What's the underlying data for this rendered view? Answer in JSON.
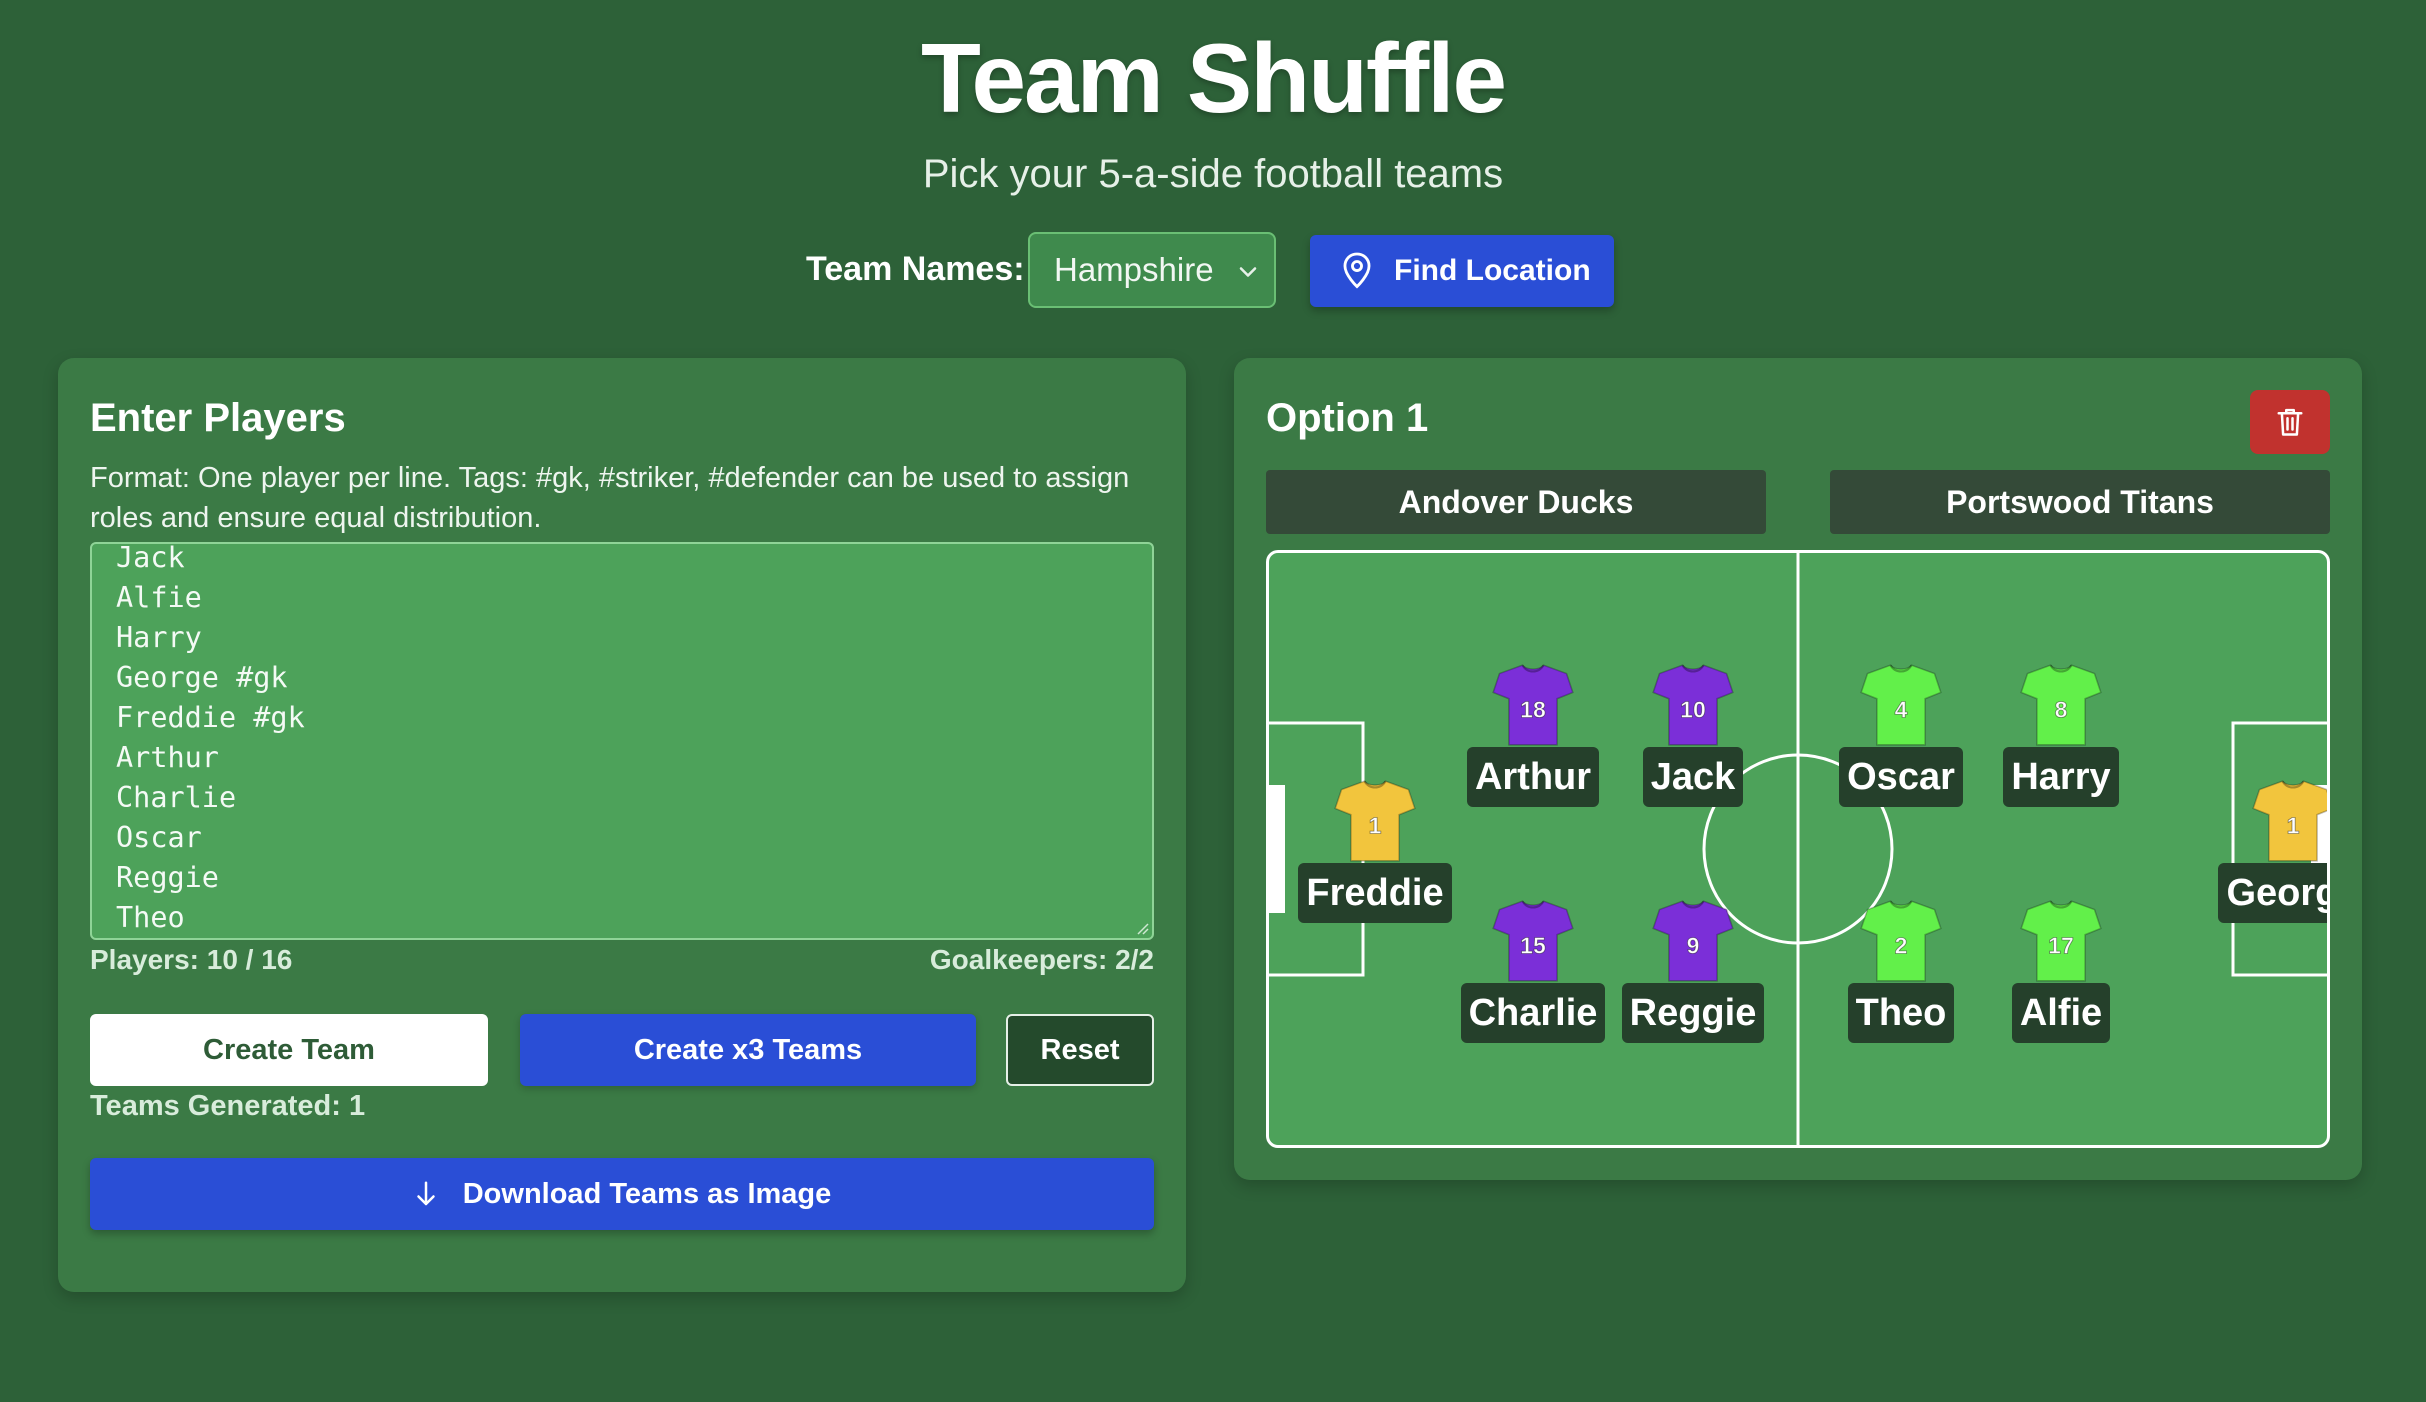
{
  "header": {
    "title": "Team Shuffle",
    "subtitle": "Pick your 5-a-side football teams"
  },
  "controls": {
    "team_names_label": "Team Names:",
    "team_names_selected": "Hampshire",
    "find_location_label": "Find Location"
  },
  "enter_players": {
    "title": "Enter Players",
    "format_text": "Format: One player per line. Tags: #gk, #striker, #defender can be used to assign roles and ensure equal distribution.",
    "lines": [
      "Jack",
      "Alfie",
      "Harry",
      "George #gk",
      "Freddie #gk",
      "Arthur",
      "Charlie",
      "Oscar",
      "Reggie",
      "Theo"
    ],
    "players_count": "Players: 10 / 16",
    "goalkeepers_count": "Goalkeepers: 2/2",
    "create_team_label": "Create Team",
    "create_x3_label": "Create x3 Teams",
    "reset_label": "Reset",
    "teams_generated": "Teams Generated: 1",
    "download_label": "Download Teams as Image"
  },
  "option": {
    "title": "Option 1",
    "team_a": "Andover Ducks",
    "team_b": "Portswood Titans",
    "colors": {
      "team_a_shirt": "#7b2fd8",
      "team_b_shirt": "#62f04a",
      "goalkeeper_shirt": "#f2c53d"
    },
    "players_a": [
      {
        "name": "Freddie",
        "number": "1",
        "role": "gk"
      },
      {
        "name": "Arthur",
        "number": "18",
        "role": "outfield"
      },
      {
        "name": "Jack",
        "number": "10",
        "role": "outfield"
      },
      {
        "name": "Charlie",
        "number": "15",
        "role": "outfield"
      },
      {
        "name": "Reggie",
        "number": "9",
        "role": "outfield"
      }
    ],
    "players_b": [
      {
        "name": "George",
        "number": "1",
        "role": "gk"
      },
      {
        "name": "Oscar",
        "number": "4",
        "role": "outfield"
      },
      {
        "name": "Harry",
        "number": "8",
        "role": "outfield"
      },
      {
        "name": "Theo",
        "number": "2",
        "role": "outfield"
      },
      {
        "name": "Alfie",
        "number": "17",
        "role": "outfield"
      }
    ]
  }
}
